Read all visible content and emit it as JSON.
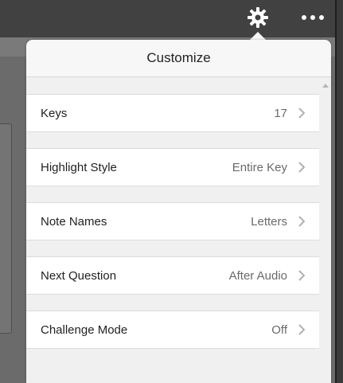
{
  "top_bar": {
    "gear_icon": "gear-icon",
    "more_icon": "more-dots-icon"
  },
  "popover": {
    "title": "Customize",
    "rows": [
      {
        "label": "Keys",
        "value": "17"
      },
      {
        "label": "Highlight Style",
        "value": "Entire Key"
      },
      {
        "label": "Note Names",
        "value": "Letters"
      },
      {
        "label": "Next Question",
        "value": "After Audio"
      },
      {
        "label": "Challenge Mode",
        "value": "Off"
      }
    ],
    "chevron_icon": "chevron-right-icon"
  },
  "colors": {
    "top_bar_bg": "#414141",
    "popover_bg": "#f0f0f0",
    "row_bg": "#ffffff",
    "value_text": "#6a6a6a",
    "chevron": "#b0b0b0"
  }
}
